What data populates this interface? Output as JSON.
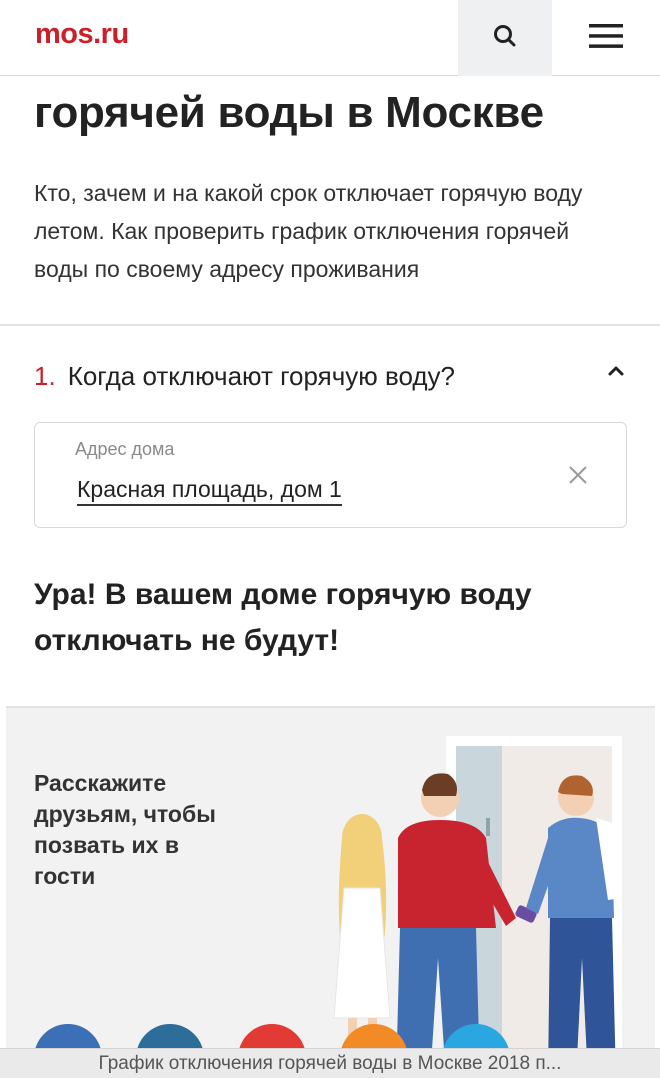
{
  "header": {
    "logo": "mos.ru",
    "search_icon": "search-icon",
    "menu_icon": "hamburger-menu-icon"
  },
  "article": {
    "title_line": "горячей воды в Москве",
    "lead": "Кто, зачем и на какой срок отключает горячую воду летом. Как проверить график отключения горячей воды по своему адресу проживания"
  },
  "accordion": {
    "number": "1.",
    "title": "Когда отключают горячую воду?",
    "expanded": true
  },
  "address_field": {
    "label": "Адрес дома",
    "value": "Красная площадь, дом 1"
  },
  "result": {
    "text": "Ура! В вашем доме горячую воду отключать не будут!"
  },
  "share": {
    "text": "Расскажите друзьям, чтобы позвать их в гости",
    "social_colors": [
      "#3b6fb6",
      "#2c6e99",
      "#e23b36",
      "#f28a25",
      "#2aa7e0"
    ]
  },
  "bottom_bar": {
    "text": "График отключения горячей воды в Москве 2018 п..."
  },
  "colors": {
    "brand_red": "#cc1f2a",
    "text_dark": "#222222",
    "text_muted": "#8a8a8a"
  }
}
